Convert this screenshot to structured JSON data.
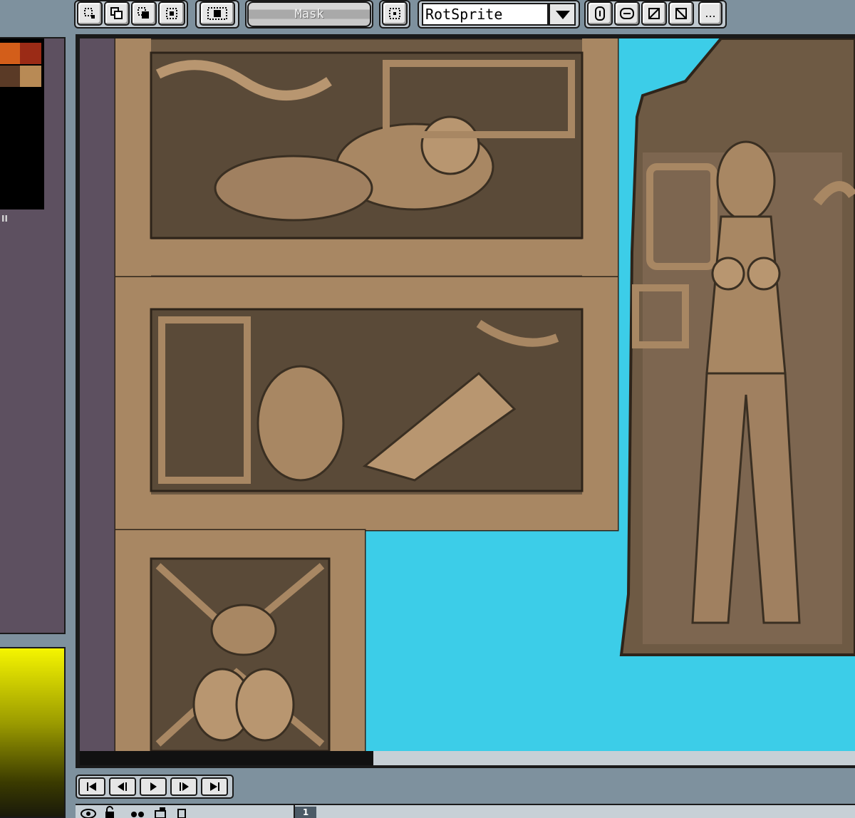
{
  "toolbar": {
    "mask_label": "Mask",
    "resize_method_value": "RotSprite",
    "more_label": "..."
  },
  "left_panel": {
    "palette_colors": [
      "#d35e1a",
      "#9b2b16",
      "#5a3a26",
      "#b88a55",
      "#000000",
      "#d2d8e0"
    ],
    "marker_text": "II"
  },
  "playback": {
    "first_label": "⏮",
    "prev_label": "◀",
    "play_label": "▶",
    "next_label": "▶",
    "last_label": "⏭"
  },
  "timeline": {
    "frame_number": "1"
  },
  "colors": {
    "canvas_background": "#3ccde8",
    "ui_background": "#7e919e",
    "stone_light": "#a88763",
    "stone_dark": "#6e5a44",
    "stone_deep": "#4a3d2f"
  }
}
